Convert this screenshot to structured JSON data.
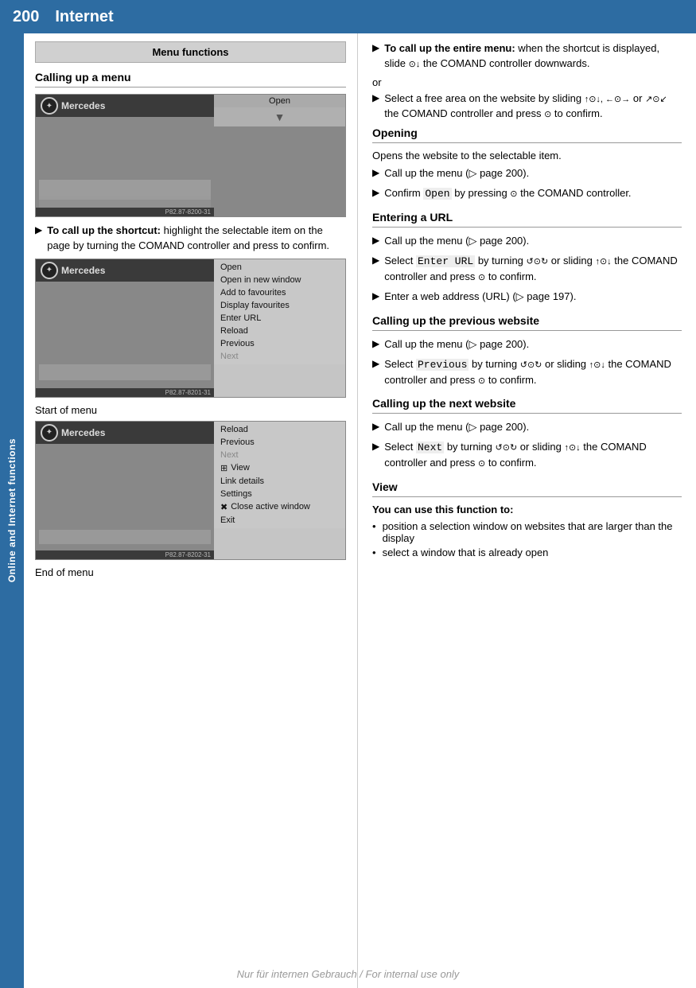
{
  "header": {
    "page_number": "200",
    "title": "Internet"
  },
  "sidebar": {
    "label": "Online and Internet functions"
  },
  "left_col": {
    "menu_functions_label": "Menu functions",
    "calling_up_menu_heading": "Calling up a menu",
    "screenshot1": {
      "mercedes_label": "Mercedes",
      "open_button": "Open",
      "footer_code": "P82.87-8200-31"
    },
    "bullet1": {
      "prefix": "To call up the shortcut:",
      "text": " highlight the selectable item on the page by turning the COMAND controller and press to confirm."
    },
    "screenshot2": {
      "mercedes_label": "Mercedes",
      "footer_code": "P82.87-8201-31",
      "menu_items": [
        {
          "label": "Open",
          "style": "normal"
        },
        {
          "label": "Open in new window",
          "style": "normal"
        },
        {
          "label": "Add to favourites",
          "style": "normal"
        },
        {
          "label": "Display favourites",
          "style": "normal"
        },
        {
          "label": "Enter URL",
          "style": "normal"
        },
        {
          "label": "Reload",
          "style": "normal"
        },
        {
          "label": "Previous",
          "style": "normal"
        },
        {
          "label": "Next",
          "style": "dimmed"
        }
      ]
    },
    "caption1": "Start of menu",
    "screenshot3": {
      "mercedes_label": "Mercedes",
      "footer_code": "P82.87-8202-31",
      "menu_items": [
        {
          "label": "Reload",
          "style": "normal"
        },
        {
          "label": "Previous",
          "style": "normal"
        },
        {
          "label": "Next",
          "style": "dimmed"
        },
        {
          "label": "View",
          "style": "normal",
          "icon": "grid"
        },
        {
          "label": "Link details",
          "style": "normal"
        },
        {
          "label": "Settings",
          "style": "normal"
        },
        {
          "label": "Close active window",
          "style": "normal",
          "icon": "x"
        },
        {
          "label": "Exit",
          "style": "normal"
        }
      ]
    },
    "caption2": "End of menu"
  },
  "right_col": {
    "bullet_entire_menu": {
      "prefix": "To call up the entire menu:",
      "text": " when the shortcut is displayed, slide the COMAND controller downwards."
    },
    "or_text": "or",
    "bullet_select_free": {
      "text": "Select a free area on the website by sliding the COMAND controller and press to confirm."
    },
    "opening_heading": "Opening",
    "opening_divider": true,
    "opening_desc": "Opens the website to the selectable item.",
    "opening_bullets": [
      "Call up the menu (▷ page 200).",
      "Confirm Open by pressing the COMAND controller."
    ],
    "entering_url_heading": "Entering a URL",
    "entering_url_bullets": [
      "Call up the menu (▷ page 200).",
      "Select Enter URL by turning or sliding the COMAND controller and press to confirm.",
      "Enter a web address (URL) (▷ page 197)."
    ],
    "calling_previous_heading": "Calling up the previous website",
    "calling_previous_bullets": [
      "Call up the menu (▷ page 200).",
      "Select Previous by turning or sliding the COMAND controller and press to confirm."
    ],
    "calling_next_heading": "Calling up the next website",
    "calling_next_bullets": [
      "Call up the menu (▷ page 200).",
      "Select Next by turning or sliding the COMAND controller and press to confirm."
    ],
    "view_heading": "View",
    "view_subheading": "You can use this function to:",
    "view_bullets": [
      "position a selection window on websites that are larger than the display",
      "select a window that is already open"
    ]
  },
  "footer": {
    "watermark": "Nur für internen Gebrauch / For internal use only"
  }
}
